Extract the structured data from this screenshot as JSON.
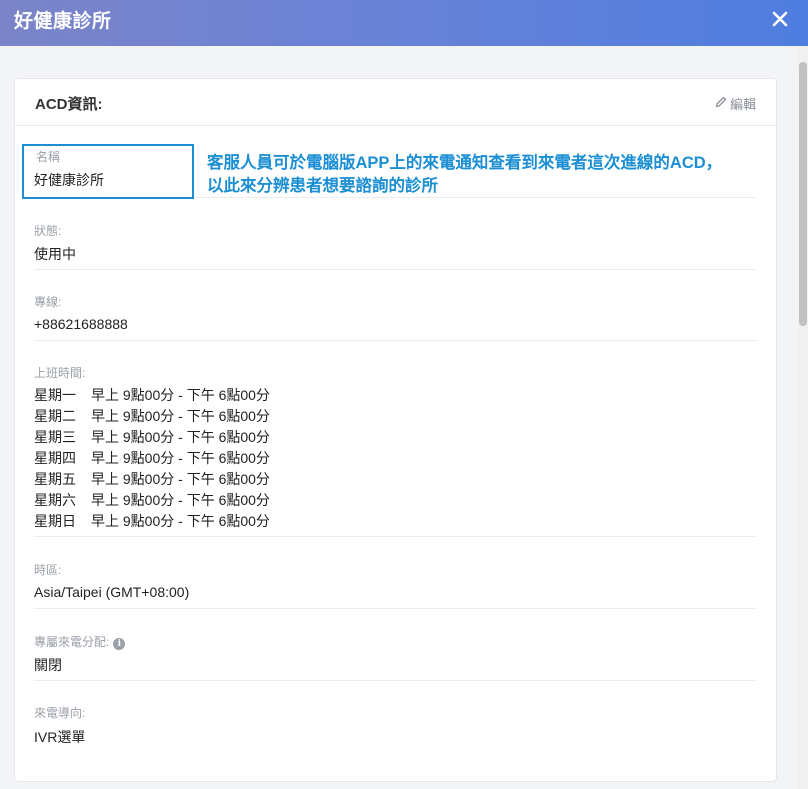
{
  "header": {
    "title": "好健康診所",
    "close_icon": "close-icon"
  },
  "card": {
    "title": "ACD資訊:",
    "edit_label": "編輯",
    "edit_icon": "pencil-icon"
  },
  "fields": {
    "name": {
      "label": "名稱",
      "value": "好健康診所"
    },
    "status": {
      "label": "狀態:",
      "value": "使用中"
    },
    "line": {
      "label": "專線:",
      "value": "+88621688888"
    },
    "hours": {
      "label": "上班時間:",
      "rows": [
        {
          "day": "星期一",
          "time": "早上 9點00分 - 下午 6點00分"
        },
        {
          "day": "星期二",
          "time": "早上 9點00分 - 下午 6點00分"
        },
        {
          "day": "星期三",
          "time": "早上 9點00分 - 下午 6點00分"
        },
        {
          "day": "星期四",
          "time": "早上 9點00分 - 下午 6點00分"
        },
        {
          "day": "星期五",
          "time": "早上 9點00分 - 下午 6點00分"
        },
        {
          "day": "星期六",
          "time": "早上 9點00分 - 下午 6點00分"
        },
        {
          "day": "星期日",
          "time": "早上 9點00分 - 下午 6點00分"
        }
      ]
    },
    "timezone": {
      "label": "時區:",
      "value": "Asia/Taipei (GMT+08:00)"
    },
    "dedicated": {
      "label": "專屬來電分配:",
      "value": "關閉",
      "info_icon": "info-icon"
    },
    "routing": {
      "label": "來電導向:",
      "value": "IVR選單"
    }
  },
  "annotation": {
    "line1": "客服人員可於電腦版APP上的來電通知查看到來電者這次進線的ACD，",
    "line2": "以此來分辨患者想要諮詢的診所"
  },
  "colors": {
    "annotation": "#1c8fd4",
    "header_start": "#7b84c8",
    "header_end": "#4f7ee0"
  }
}
